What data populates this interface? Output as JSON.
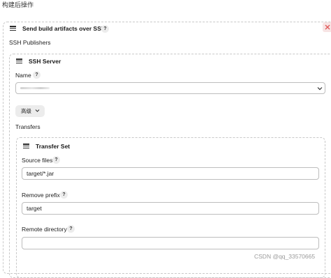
{
  "page": {
    "heading": "构建后操作"
  },
  "step": {
    "title": "Send build artifacts over SSH",
    "help": "?",
    "publishers_label": "SSH Publishers"
  },
  "ssh_server": {
    "title": "SSH Server",
    "name_label": "Name",
    "name_help": "?",
    "name_value": "",
    "advanced_button": "高级",
    "transfers_label": "Transfers"
  },
  "transfer_set": {
    "title": "Transfer Set",
    "source_files_label": "Source files",
    "source_files_help": "?",
    "source_files_value": "target/*.jar",
    "remove_prefix_label": "Remove prefix",
    "remove_prefix_help": "?",
    "remove_prefix_value": "target",
    "remote_directory_label": "Remote directory",
    "remote_directory_help": "?",
    "remote_directory_value": ""
  },
  "watermark": "CSDN @qq_33570665",
  "colors": {
    "close_icon": "#e05a5a",
    "border": "#c8c8c8",
    "button_bg": "#ececec"
  },
  "icons": [
    "drag-handle-icon",
    "help-icon",
    "chevron-down-icon",
    "close-icon"
  ]
}
